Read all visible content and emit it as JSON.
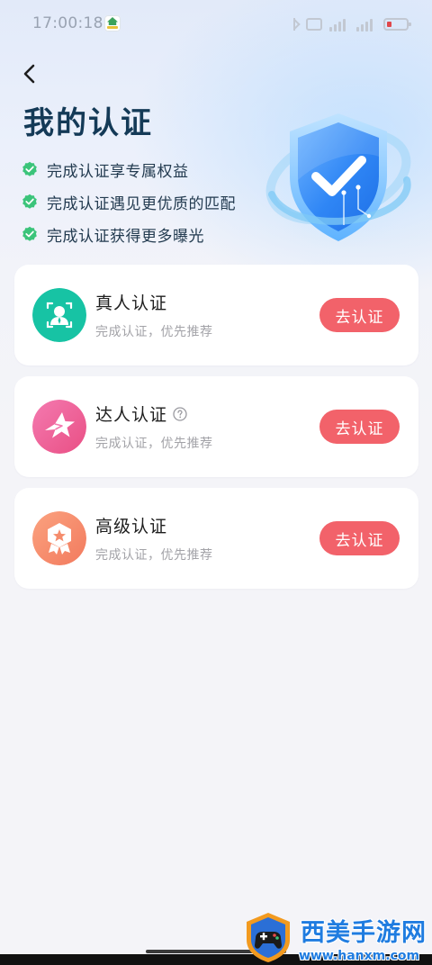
{
  "status_bar": {
    "time": "17:00:18",
    "icons": [
      "app-notification-icon",
      "bluetooth-icon",
      "nfc-icon",
      "signal-icon",
      "signal-icon",
      "battery-icon"
    ],
    "battery_color": "#e0474c"
  },
  "header": {
    "back_icon": "chevron-left-icon",
    "title": "我的认证",
    "benefits": [
      "完成认证享专属权益",
      "完成认证遇见更优质的匹配",
      "完成认证获得更多曝光"
    ],
    "check_color": "#3bc47a"
  },
  "certifications": [
    {
      "title": "真人认证",
      "subtitle": "完成认证，优先推荐",
      "button": "去认证",
      "icon": "person-verify-icon",
      "icon_color": "#17c3a4"
    },
    {
      "title": "达人认证",
      "subtitle": "完成认证，优先推荐",
      "button": "去认证",
      "icon": "star-icon",
      "icon_color": "#ef5f93",
      "help_icon": "help-icon"
    },
    {
      "title": "高级认证",
      "subtitle": "完成认证，优先推荐",
      "button": "去认证",
      "icon": "badge-icon",
      "icon_color": "#f58c6c"
    }
  ],
  "colors": {
    "title": "#143a57",
    "button": "#f2626a",
    "card": "#ffffff",
    "background": "#f4f4f8"
  },
  "watermark": {
    "name": "西美手游网",
    "url": "www.hanxm.com"
  }
}
